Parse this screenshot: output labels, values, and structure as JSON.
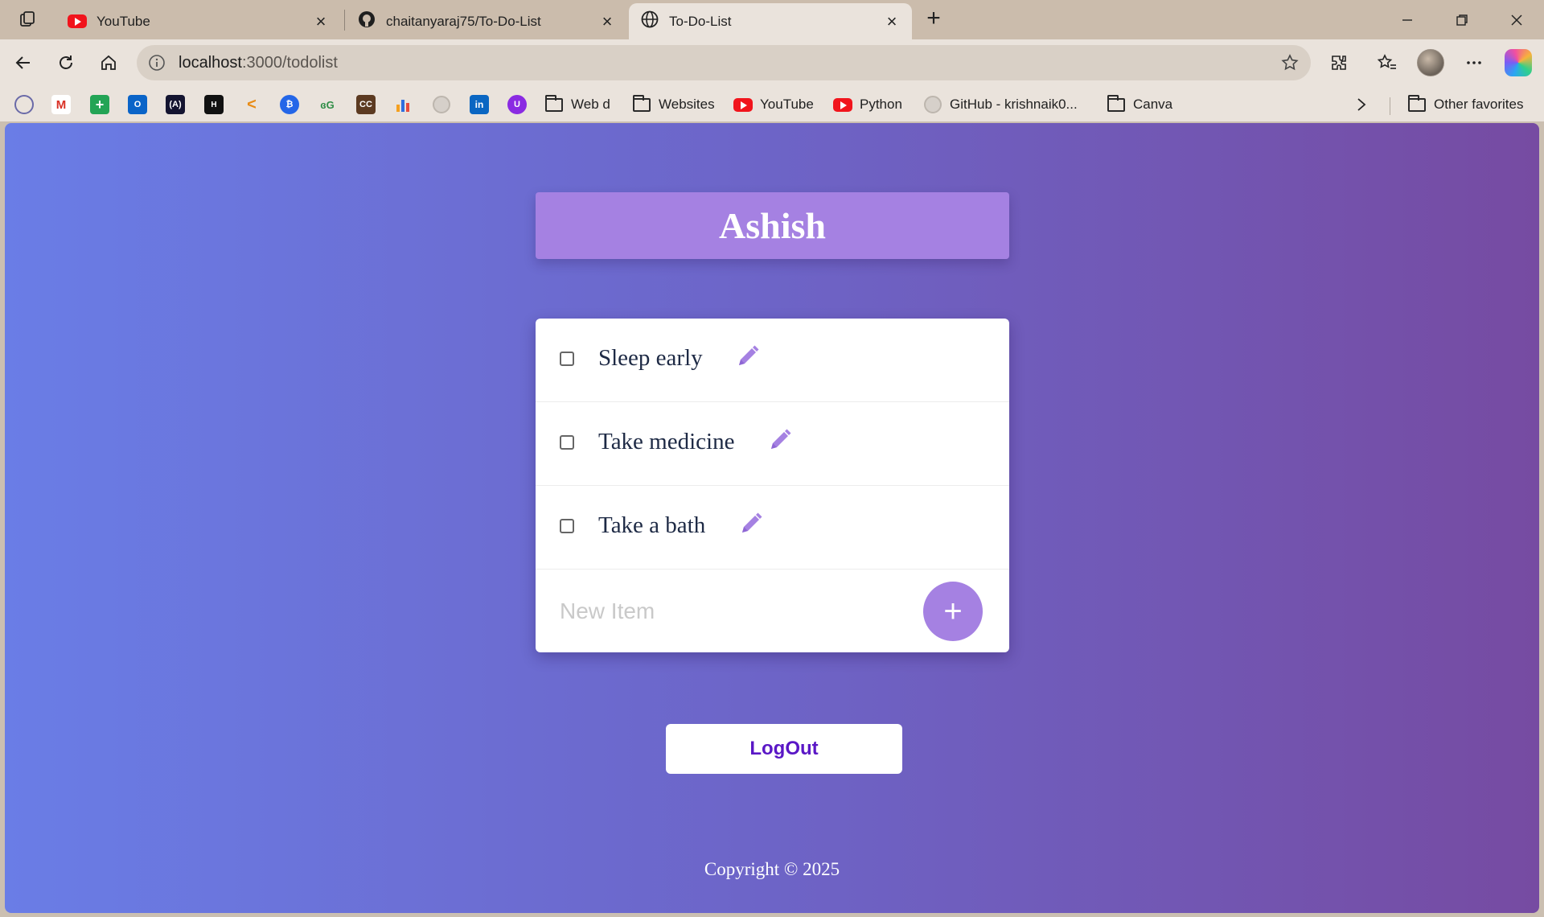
{
  "browser": {
    "tabs": [
      {
        "title": "YouTube",
        "icon": "youtube-icon"
      },
      {
        "title": "chaitanyaraj75/To-Do-List",
        "icon": "github-icon"
      },
      {
        "title": "To-Do-List",
        "icon": "globe-icon",
        "active": true
      }
    ],
    "address": {
      "host": "localhost",
      "rest": ":3000/todolist"
    },
    "bookmarks": {
      "web_d": "Web d",
      "websites": "Websites",
      "youtube": "YouTube",
      "python": "Python",
      "github": "GitHub - krishnaik0...",
      "canva": "Canva",
      "other": "Other favorites"
    }
  },
  "page": {
    "user_name": "Ashish",
    "items": [
      "Sleep early",
      "Take medicine",
      "Take a bath"
    ],
    "new_item_placeholder": "New Item",
    "add_label": "+",
    "logout_label": "LogOut",
    "footer": "Copyright © 2025"
  },
  "colors": {
    "gradient_start": "#6a7de6",
    "gradient_end": "#764ba2",
    "accent": "#a581e2",
    "logout_text": "#5a17c6"
  }
}
